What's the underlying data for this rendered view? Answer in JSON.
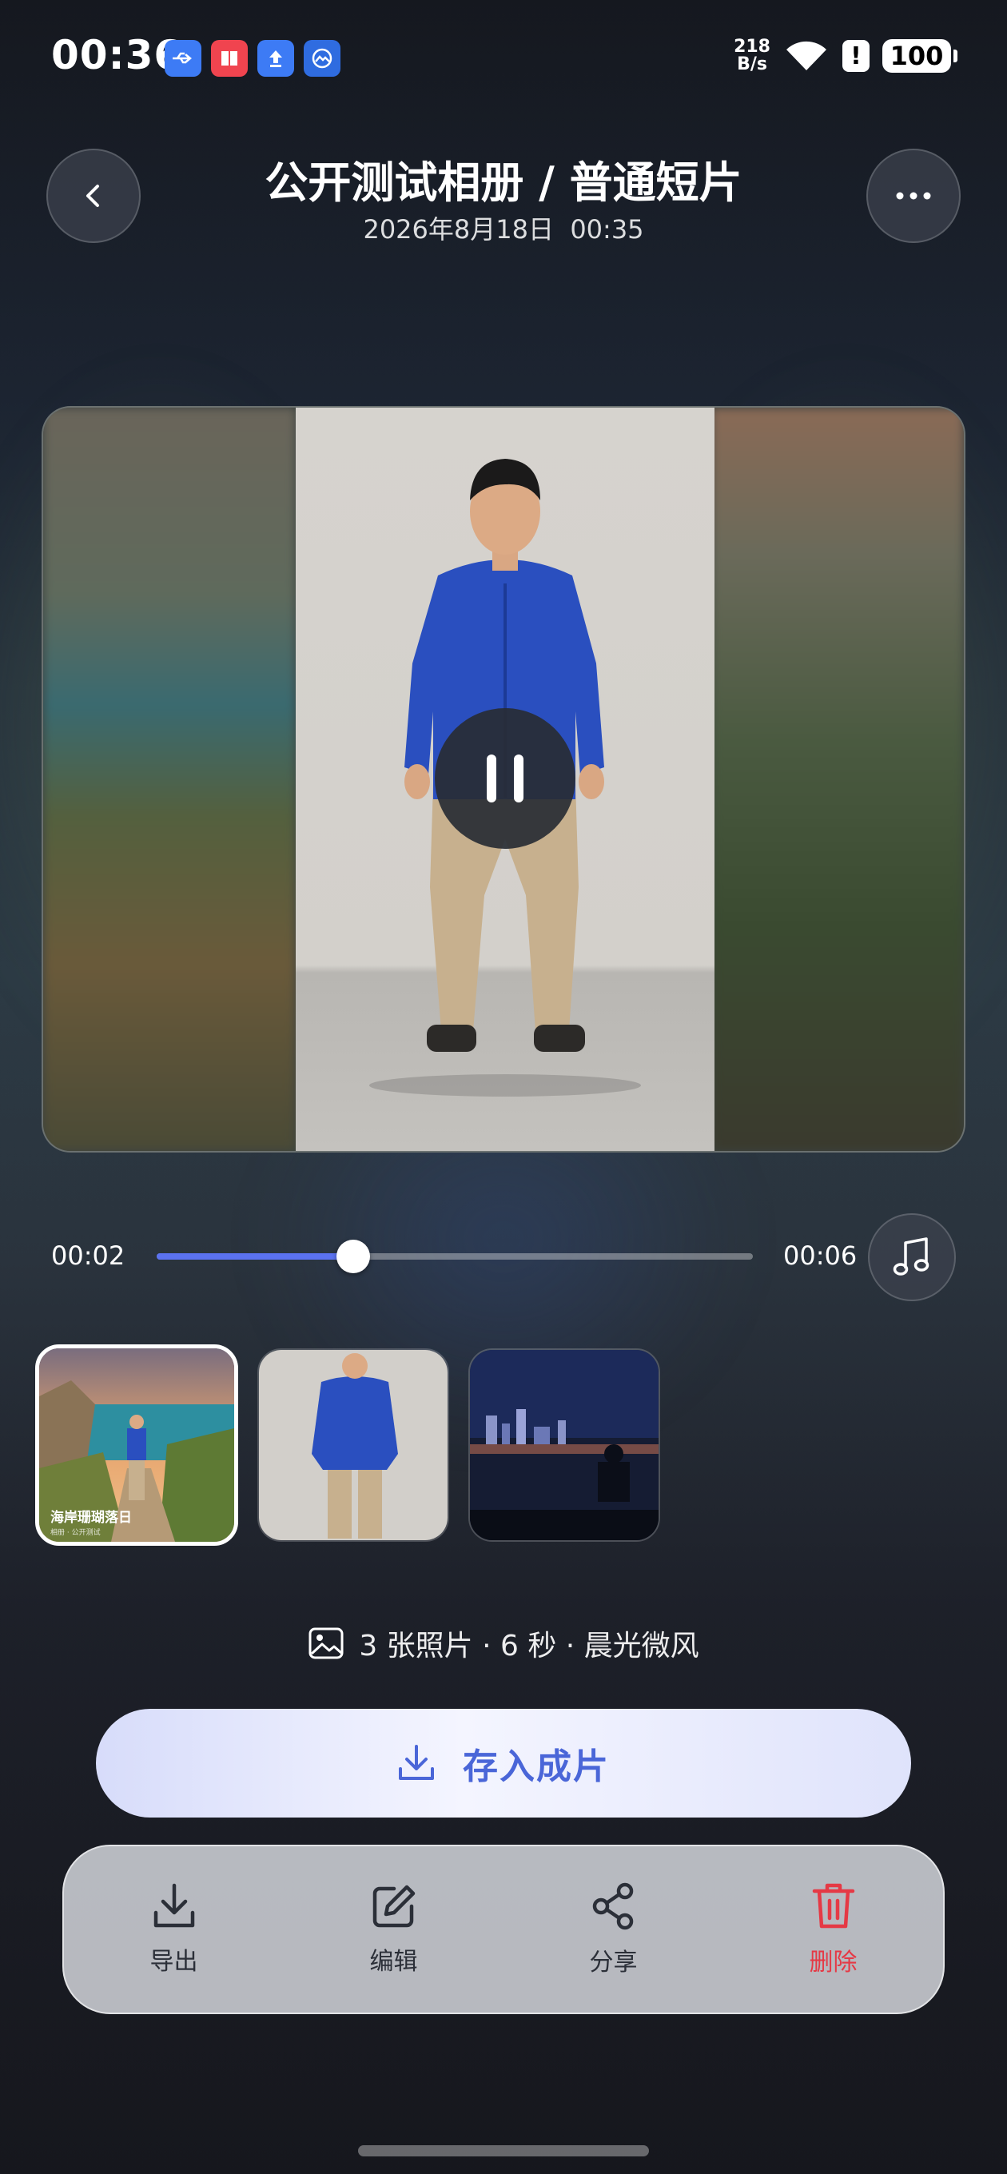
{
  "status_bar": {
    "time": "00:36",
    "net_speed_value": "218",
    "net_speed_unit": "B/s",
    "battery": "100",
    "notif_icons": [
      "usb-icon",
      "app-book-icon",
      "upload-icon",
      "gallery-app-icon"
    ]
  },
  "header": {
    "title": "公开测试相册 / 普通短片",
    "subtitle": "2026年8月18日  00:35"
  },
  "player": {
    "state": "playing",
    "control_icon": "pause-icon"
  },
  "progress": {
    "current": "00:02",
    "total": "00:06",
    "fraction": 0.33
  },
  "thumbnails": [
    {
      "label": "海岸珊瑚落日",
      "sub": "相册 · 公开测试",
      "selected": true
    },
    {
      "label": "",
      "sub": "",
      "selected": false
    },
    {
      "label": "",
      "sub": "",
      "selected": false
    }
  ],
  "info": {
    "text": "3 张照片 · 6 秒 · 晨光微风",
    "icon": "image-icon"
  },
  "save_button": {
    "label": "存入成片",
    "icon": "download-icon"
  },
  "actions": [
    {
      "label": "导出",
      "icon": "download-icon"
    },
    {
      "label": "编辑",
      "icon": "edit-icon"
    },
    {
      "label": "分享",
      "icon": "share-icon"
    },
    {
      "label": "删除",
      "icon": "trash-icon",
      "color": "#e53945"
    }
  ],
  "colors": {
    "accent": "#5b72f0",
    "save_text": "#4a66d8",
    "danger": "#e53945"
  }
}
